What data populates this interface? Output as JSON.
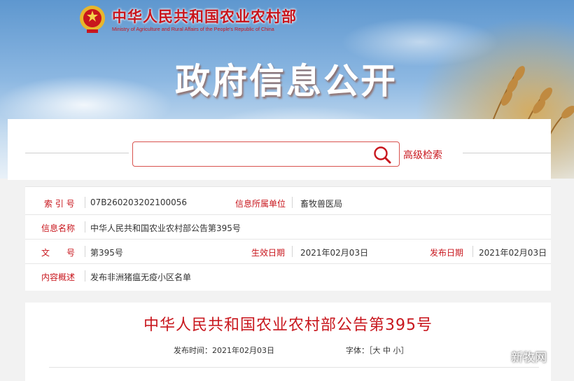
{
  "header": {
    "ministry_name_cn": "中华人民共和国农业农村部",
    "ministry_name_en": "Ministry of Agriculture and Rural Affairs of the People's Republic of China",
    "page_title": "政府信息公开",
    "emblem_icon": "national-emblem-icon"
  },
  "search": {
    "placeholder": "",
    "advanced_label": "高级检索",
    "icon": "search-icon"
  },
  "meta": {
    "index_label": "索 引 号",
    "index_value": "07B260203202100056",
    "unit_label": "信息所属单位",
    "unit_value": "畜牧兽医局",
    "name_label": "信息名称",
    "name_value": "中华人民共和国农业农村部公告第395号",
    "doc_label": "文　　号",
    "doc_value": "第395号",
    "effective_label": "生效日期",
    "effective_value": "2021年02月03日",
    "publish_label": "发布日期",
    "publish_value": "2021年02月03日",
    "summary_label": "内容概述",
    "summary_value": "发布非洲猪瘟无疫小区名单"
  },
  "article": {
    "title": "中华人民共和国农业农村部公告第395号",
    "publish_time_label": "发布时间：2021年02月03日",
    "font_label": "字体：",
    "font_open": "［",
    "font_large": "大",
    "font_medium": "中",
    "font_small": "小",
    "font_close": "］"
  },
  "watermark": {
    "text": "新牧网",
    "icon": "wechat-icon"
  },
  "colors": {
    "accent": "#c8161d",
    "border": "#e6e6e6"
  }
}
